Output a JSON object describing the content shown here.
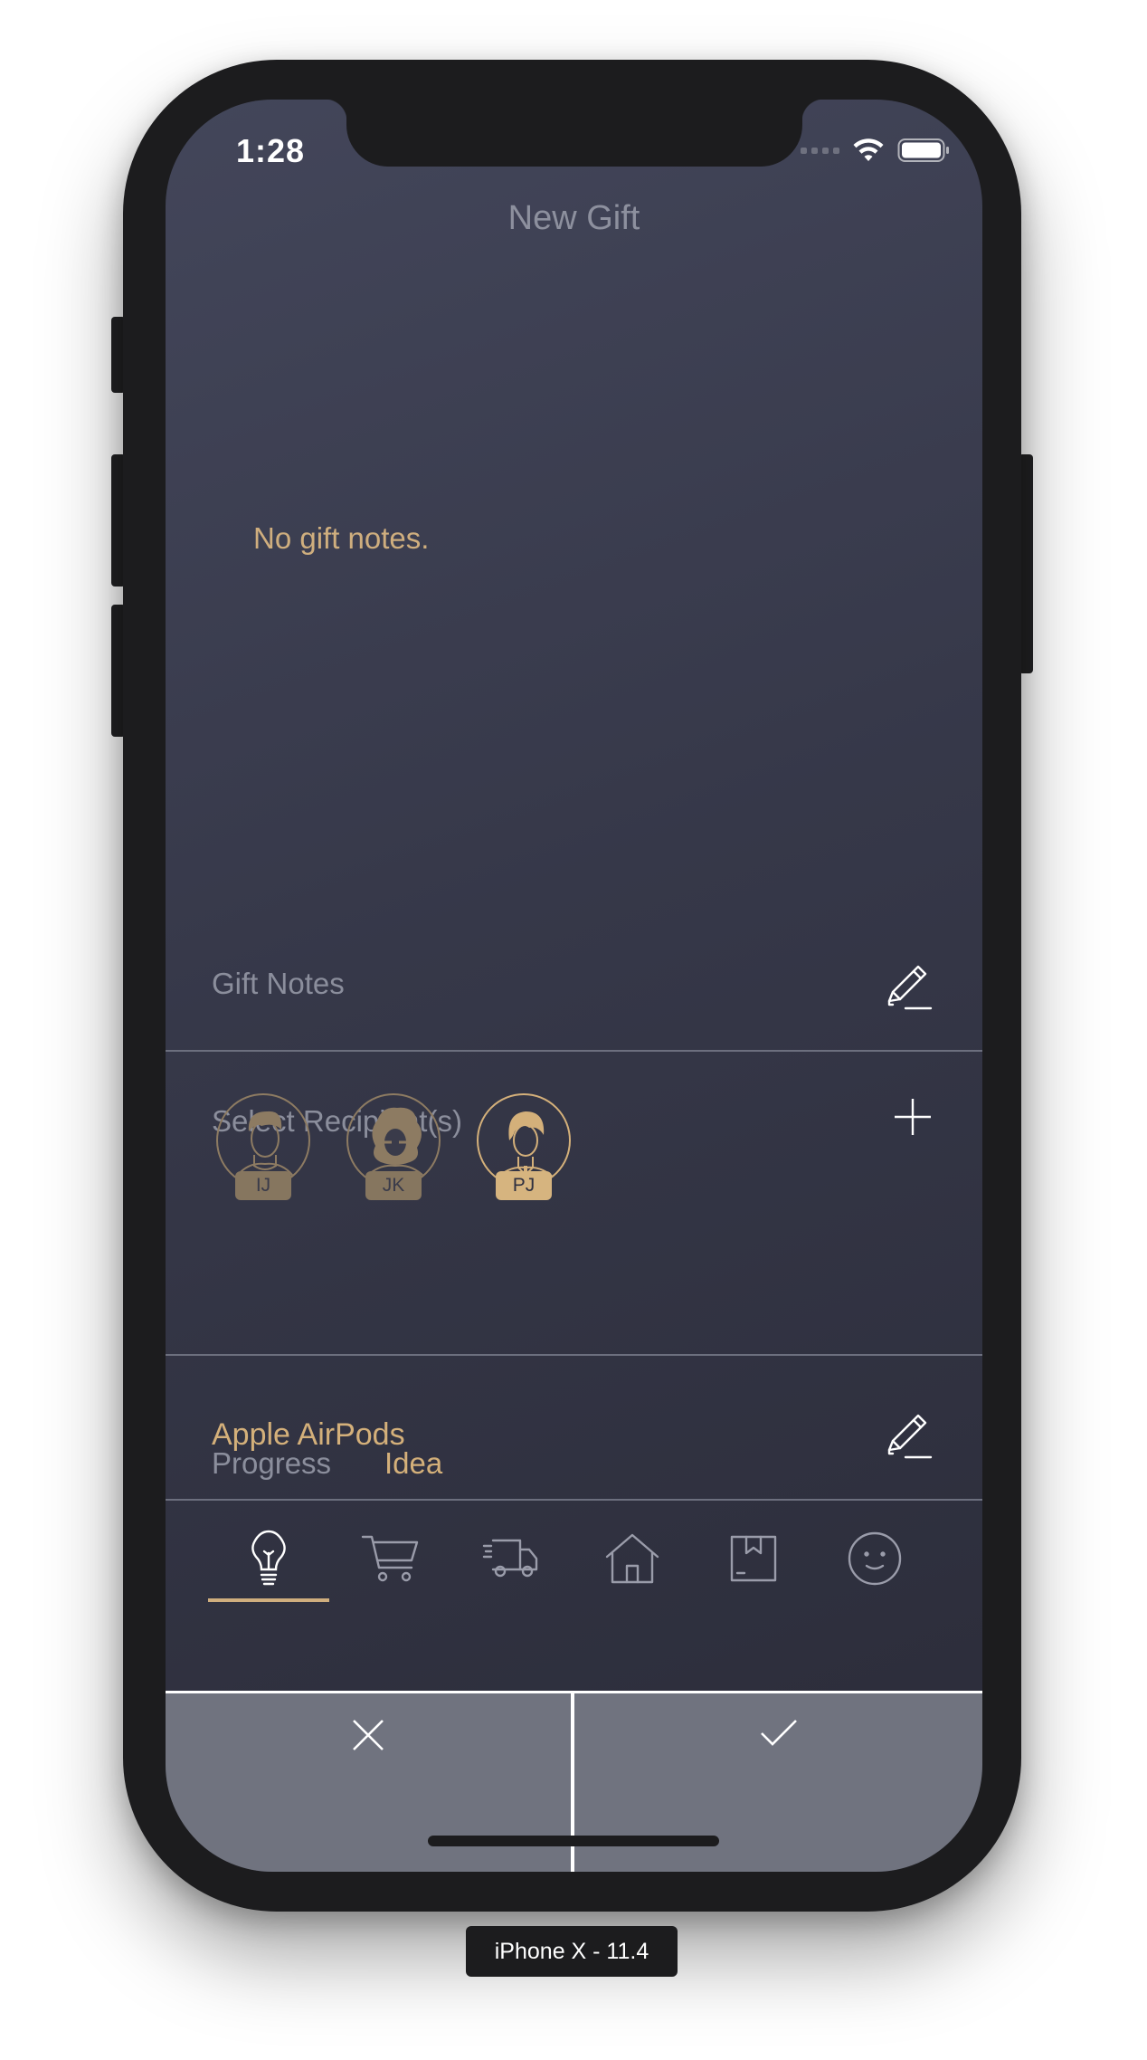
{
  "status_bar": {
    "time": "1:28"
  },
  "nav": {
    "title": "New Gift"
  },
  "notes": {
    "placeholder_text": "No gift notes.",
    "section_label": "Gift Notes"
  },
  "recipients": {
    "section_label": "Select Recipient(s)",
    "people": [
      {
        "initials": "IJ",
        "selected": false
      },
      {
        "initials": "JK",
        "selected": false
      },
      {
        "initials": "PJ",
        "selected": true
      }
    ]
  },
  "gift": {
    "name": "Apple AirPods"
  },
  "progress": {
    "label": "Progress",
    "current_stage": "Idea",
    "stages": [
      "lightbulb-icon",
      "cart-icon",
      "truck-icon",
      "house-icon",
      "box-icon",
      "smiley-icon"
    ],
    "selected_index": 0
  },
  "device": {
    "label": "iPhone X - 11.4"
  },
  "colors": {
    "accent": "#d4b07a",
    "muted_text": "#8b8e9c",
    "background_top": "#43465a",
    "background_bottom": "#2b2c39",
    "action_bar": "#70737f"
  }
}
